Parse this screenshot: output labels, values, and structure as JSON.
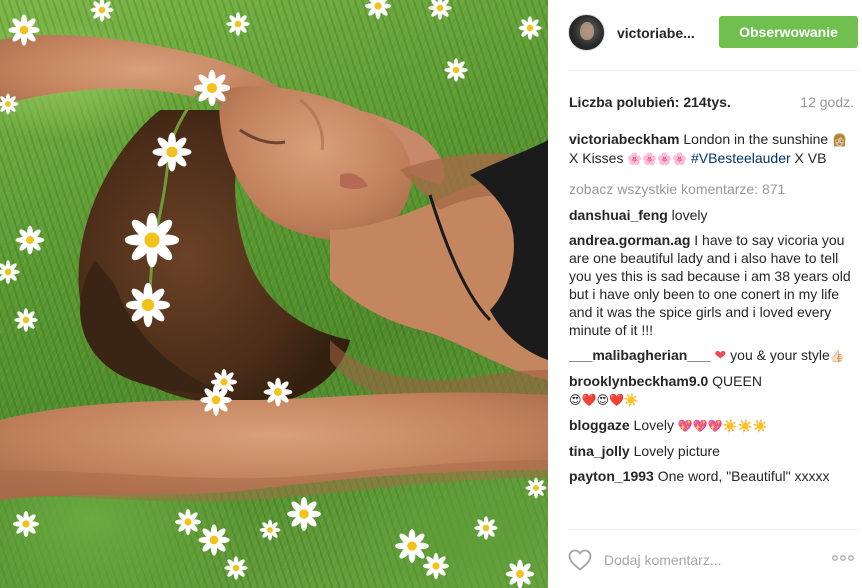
{
  "photo": {
    "alt": "photo-of-woman-lying-on-grass-with-daisy-crown"
  },
  "header": {
    "username": "victoriabe...",
    "follow_label": "Obserwowanie",
    "follow_color": "#70c050"
  },
  "stats": {
    "likes": "Liczba polubień: 214tys.",
    "time": "12 godz."
  },
  "caption": {
    "user": "victoriabeckham",
    "text1": " London in the sunshine ",
    "emoji1": "👩🏼",
    "text2": " X Kisses ",
    "emoji2": "🌸🌸🌸🌸",
    "hashtag": " #VBesteelauder",
    "text3": " X VB"
  },
  "view_all": "zobacz wszystkie komentarze: 871",
  "comments": [
    {
      "user": "danshuai_feng",
      "text": " lovely",
      "emoji": ""
    },
    {
      "user": "andrea.gorman.ag",
      "text": " I have to say vicoria you are one beautiful lady and i also have to tell you yes this is sad because i am 38 years old but i have only been to one conert in my life and it was the spice girls and i loved every minute of it !!!",
      "emoji": ""
    },
    {
      "user": "___malibagherian___",
      "text": " ❤ you & your style",
      "emoji": "👍🏻"
    },
    {
      "user": "brooklynbeckham9.0",
      "text": " QUEEN",
      "emoji": "😍❤️😍❤️☀️"
    },
    {
      "user": "bloggaze",
      "text": " Lovely ",
      "emoji": "💖💖💖☀️☀️☀️"
    },
    {
      "user": "tina_jolly",
      "text": " Lovely picture",
      "emoji": ""
    },
    {
      "user": "payton_1993",
      "text": " One word, \"Beautiful\" xxxxx",
      "emoji": ""
    }
  ],
  "bottom": {
    "placeholder": "Dodaj komentarz...",
    "like_icon": "heart-outline-icon",
    "more_icon": "more-options-icon"
  },
  "colors": {
    "hashtag": "#003569",
    "muted": "#999999",
    "heart": "#ed4956"
  }
}
